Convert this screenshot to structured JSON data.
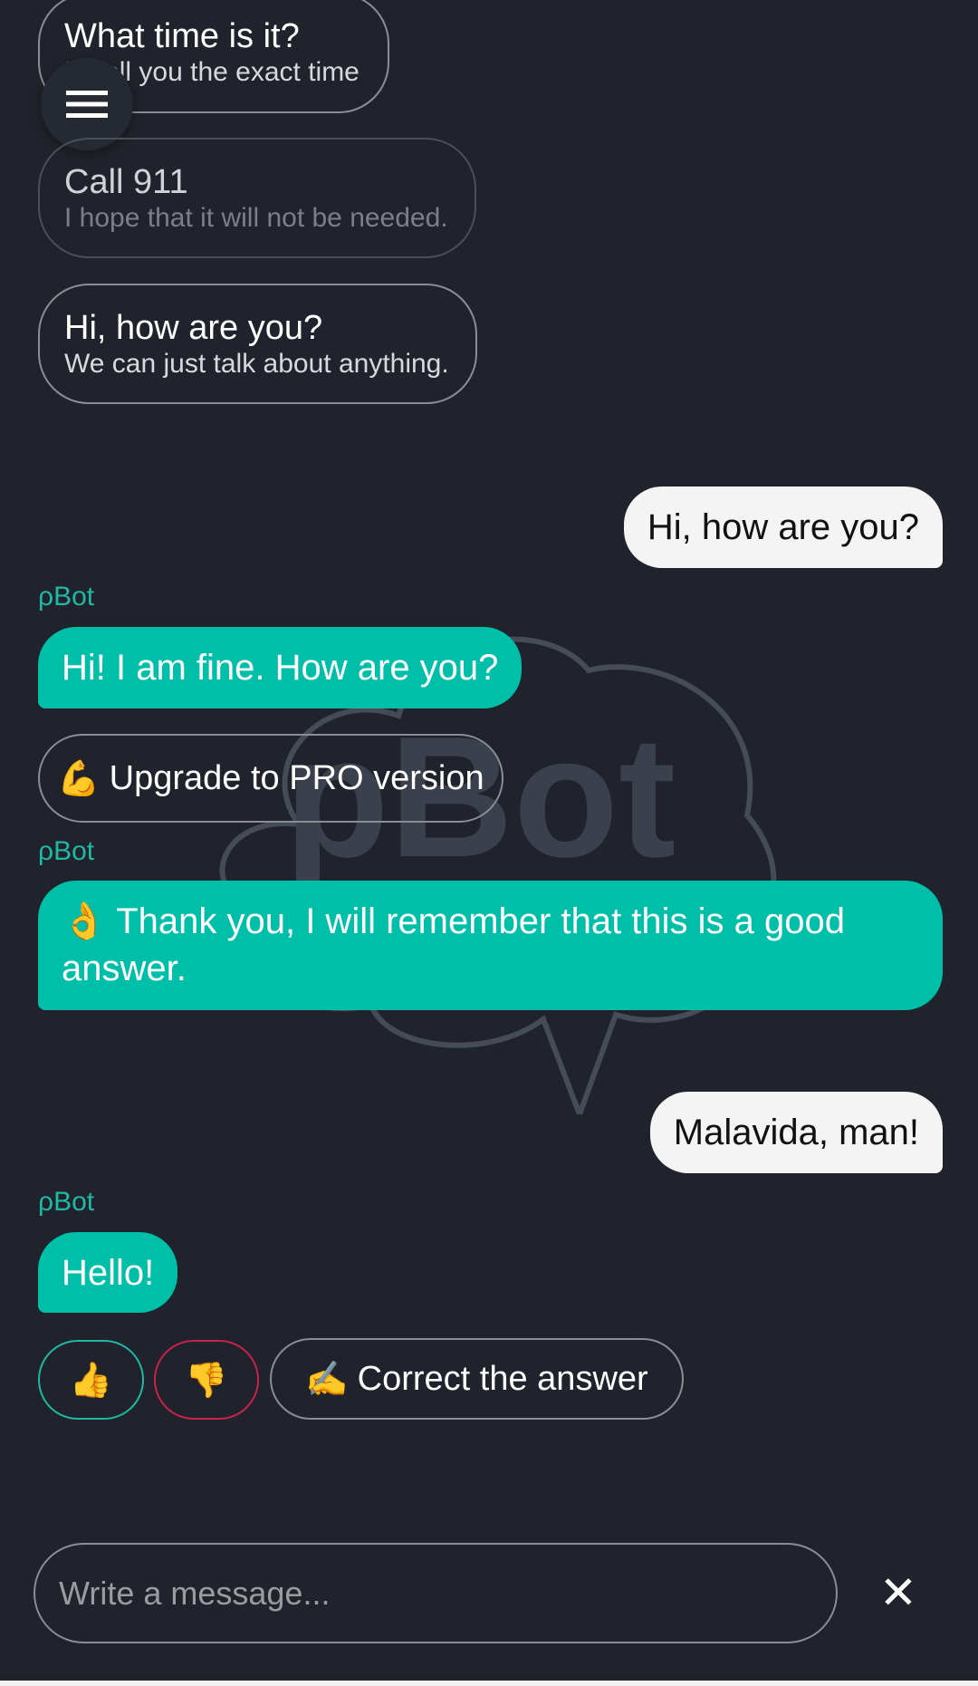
{
  "suggestions": [
    {
      "title": "What time is it?",
      "subtitle": "I'll tell you the exact time"
    },
    {
      "title": "Call 911",
      "subtitle": "I hope that it will not be needed."
    },
    {
      "title": "Hi, how are you?",
      "subtitle": "We can just talk about anything."
    }
  ],
  "watermark": "pBot",
  "messages": [
    {
      "from": "user",
      "text": "Hi, how are you?"
    },
    {
      "from": "bot",
      "sender": "ρBot",
      "text": "Hi! I am fine. How are you?"
    },
    {
      "from": "bot-action",
      "emoji": "💪",
      "text": "Upgrade to PRO version"
    },
    {
      "from": "bot",
      "sender": "ρBot",
      "emoji": "👌",
      "text": "Thank you, I will remember that this is a good answer."
    },
    {
      "from": "user",
      "text": "Malavida, man!"
    },
    {
      "from": "bot",
      "sender": "ρBot",
      "text": "Hello!"
    }
  ],
  "feedback": {
    "thumbs_up": "👍",
    "thumbs_down": "👎",
    "correct_emoji": "✍️",
    "correct_label": "Correct the answer"
  },
  "composer": {
    "placeholder": "Write a message...",
    "close": "✕"
  },
  "colors": {
    "background": "#20232b",
    "accent": "#00bfa9",
    "user_bubble": "#f4f4f4",
    "like": "#1fb9a5",
    "dislike": "#c8234a"
  }
}
